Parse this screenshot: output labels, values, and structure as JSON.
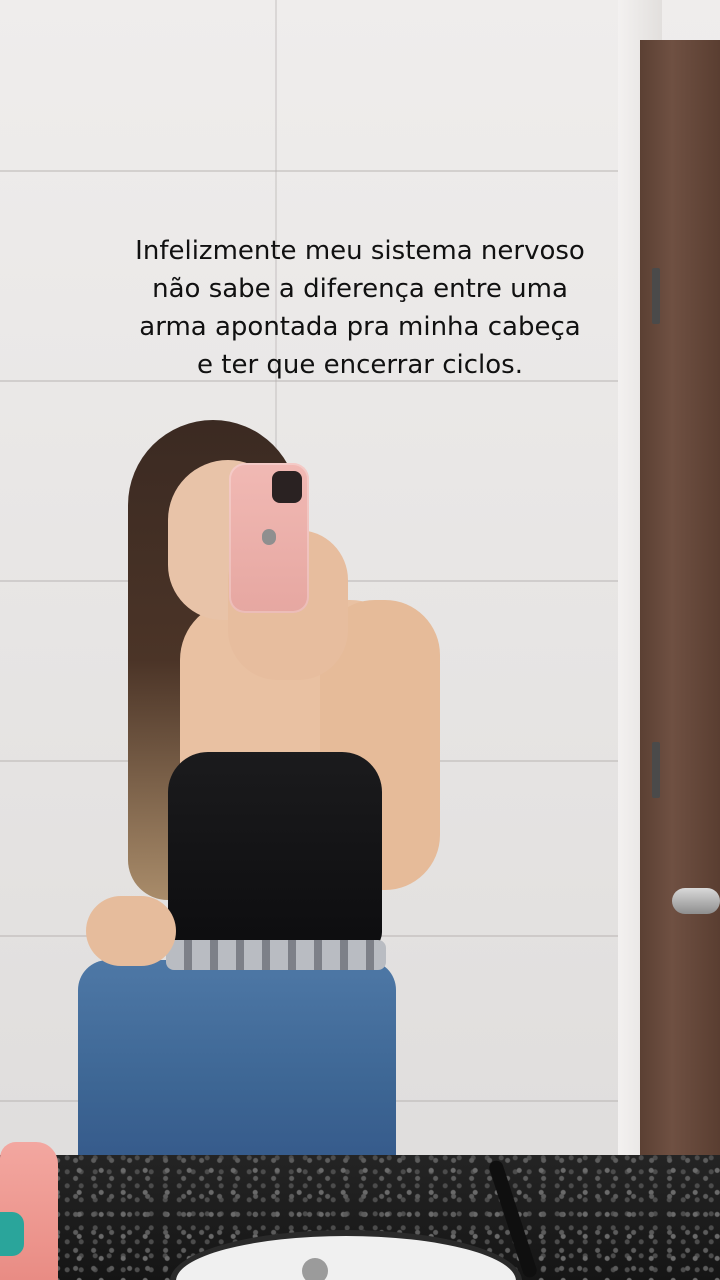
{
  "caption": {
    "lines": [
      "Infelizmente meu sistema nervoso",
      "não sabe a diferença entre uma",
      "arma apontada pra minha cabeça",
      "e ter que encerrar ciclos."
    ]
  },
  "scene": {
    "wall_color": "#e9e7e6",
    "door_color": "#5f4335",
    "counter_color": "#1c1c1c",
    "phone_case_color": "#f0b6b0",
    "top_color": "#121214",
    "jeans_color": "#3f6896"
  }
}
